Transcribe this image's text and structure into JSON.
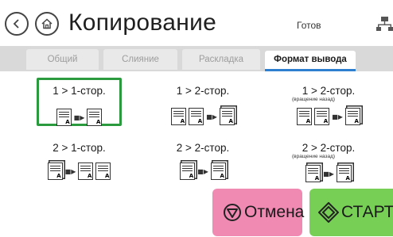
{
  "header": {
    "title": "Копирование",
    "status": "Готов",
    "icons": [
      "back-arrow-icon",
      "home-icon",
      "network-icon"
    ]
  },
  "tabs": [
    {
      "label": "Общий",
      "active": false
    },
    {
      "label": "Слияние",
      "active": false
    },
    {
      "label": "Раскладка",
      "active": false
    },
    {
      "label": "Формат вывода",
      "active": true
    }
  ],
  "options": [
    {
      "label": "1 > 1-стор.",
      "sub": "",
      "selected": true
    },
    {
      "label": "1 > 2-стор.",
      "sub": "",
      "selected": false
    },
    {
      "label": "1 > 2-стор.",
      "sub": "(вращение назад)",
      "selected": false
    },
    {
      "label": "2 > 1-стор.",
      "sub": "",
      "selected": false
    },
    {
      "label": "2 > 2-стор.",
      "sub": "",
      "selected": false
    },
    {
      "label": "2 > 2-стор.",
      "sub": "(вращение назад)",
      "selected": false
    }
  ],
  "buttons": {
    "cancel": "Отмена",
    "start": "СТАРТ"
  },
  "colors": {
    "selected_border": "#2b9a3f",
    "cancel_bg": "#f08ab3",
    "start_bg": "#78cf56",
    "active_tab_underline": "#2f7fd1"
  }
}
